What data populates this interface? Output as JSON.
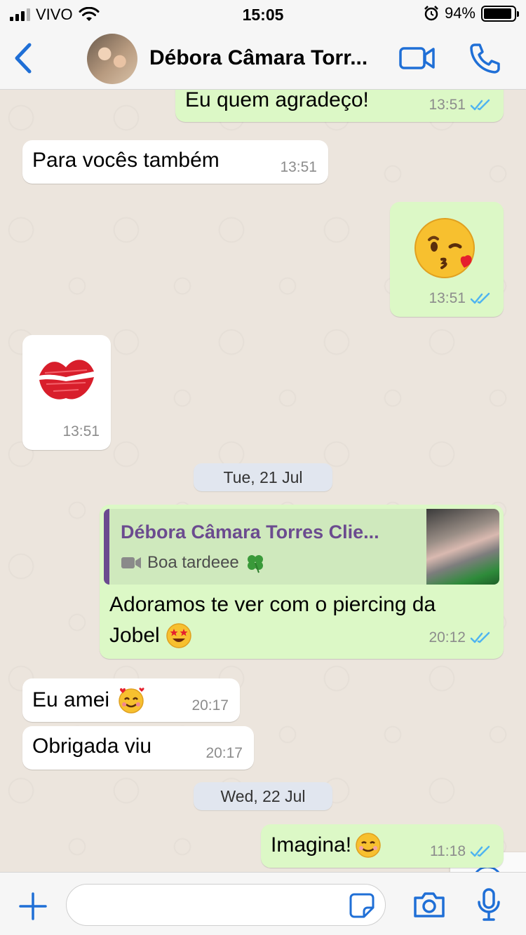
{
  "status_bar": {
    "carrier": "VIVO",
    "time": "15:05",
    "battery_pct": "94%",
    "battery_level": 0.94,
    "icons": [
      "signal-icon",
      "wifi-icon",
      "alarm-icon",
      "battery-icon"
    ]
  },
  "header": {
    "contact_name": "Débora Câmara Torr...",
    "icons": [
      "back-chevron-icon",
      "video-call-icon",
      "phone-icon"
    ]
  },
  "messages": [
    {
      "dir": "out",
      "text": "Eu quem agradeço!",
      "time": "13:51",
      "read": true
    },
    {
      "dir": "in",
      "text": "Para vocês também",
      "time": "13:51"
    },
    {
      "dir": "out",
      "emoji": "kissing-face-with-heart",
      "time": "13:51",
      "read": true
    },
    {
      "dir": "in",
      "emoji": "kiss-mark",
      "time": "13:51"
    },
    {
      "type": "date",
      "text": "Tue, 21 Jul"
    },
    {
      "dir": "out",
      "quote": {
        "name": "Débora Câmara Torres Clie...",
        "text": "Boa tardeee",
        "icon": "video-icon",
        "emoji": "four-leaf-clover",
        "thumbnail": "video-thumbnail"
      },
      "text_line1": "Adoramos te ver com o piercing da",
      "text_line2": "Jobel",
      "emoji": "star-struck",
      "time": "20:12",
      "read": true
    },
    {
      "dir": "in",
      "text": "Eu amei",
      "emoji": "smiling-face-with-hearts",
      "time": "20:17"
    },
    {
      "dir": "in",
      "text": "Obrigada viu",
      "time": "20:17"
    },
    {
      "type": "date",
      "text": "Wed, 22 Jul"
    },
    {
      "dir": "out",
      "text": "Imagina!",
      "emoji": "smiling-face",
      "time": "11:18",
      "read": true
    }
  ],
  "input_bar": {
    "placeholder": "",
    "icons": [
      "plus-icon",
      "sticker-icon",
      "camera-icon",
      "microphone-icon"
    ]
  },
  "colors": {
    "outgoing_bubble": "#dcf8c6",
    "incoming_bubble": "#ffffff",
    "chat_background": "#ece5dd",
    "ios_blue": "#1f6fd6",
    "read_ticks": "#4fb4f0",
    "quote_accent": "#6b4b8f"
  }
}
